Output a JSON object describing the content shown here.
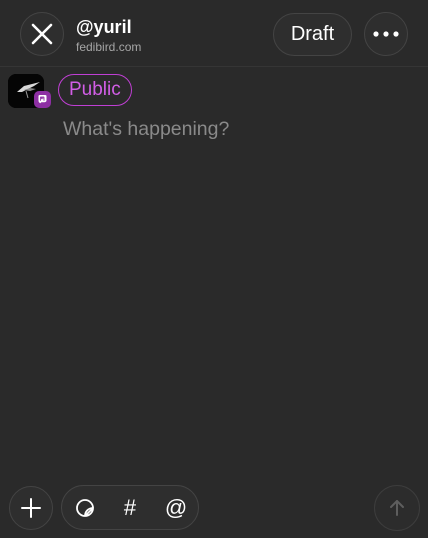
{
  "header": {
    "handle": "@yuril",
    "domain": "fedibird.com",
    "draft_label": "Draft"
  },
  "post": {
    "visibility": "Public",
    "placeholder": "What's happening?"
  },
  "toolbar": {
    "hashtag_symbol": "#",
    "mention_symbol": "@"
  },
  "colors": {
    "background": "#2a2a2a",
    "accent": "#c03fd4",
    "badge": "#8d2fa3",
    "placeholder": "#8a8a8a"
  },
  "icons": [
    "close-icon",
    "more-icon",
    "mastodon-badge-icon",
    "plus-icon",
    "emoji-sticker-icon",
    "hashtag-icon",
    "mention-icon",
    "arrow-up-icon"
  ]
}
